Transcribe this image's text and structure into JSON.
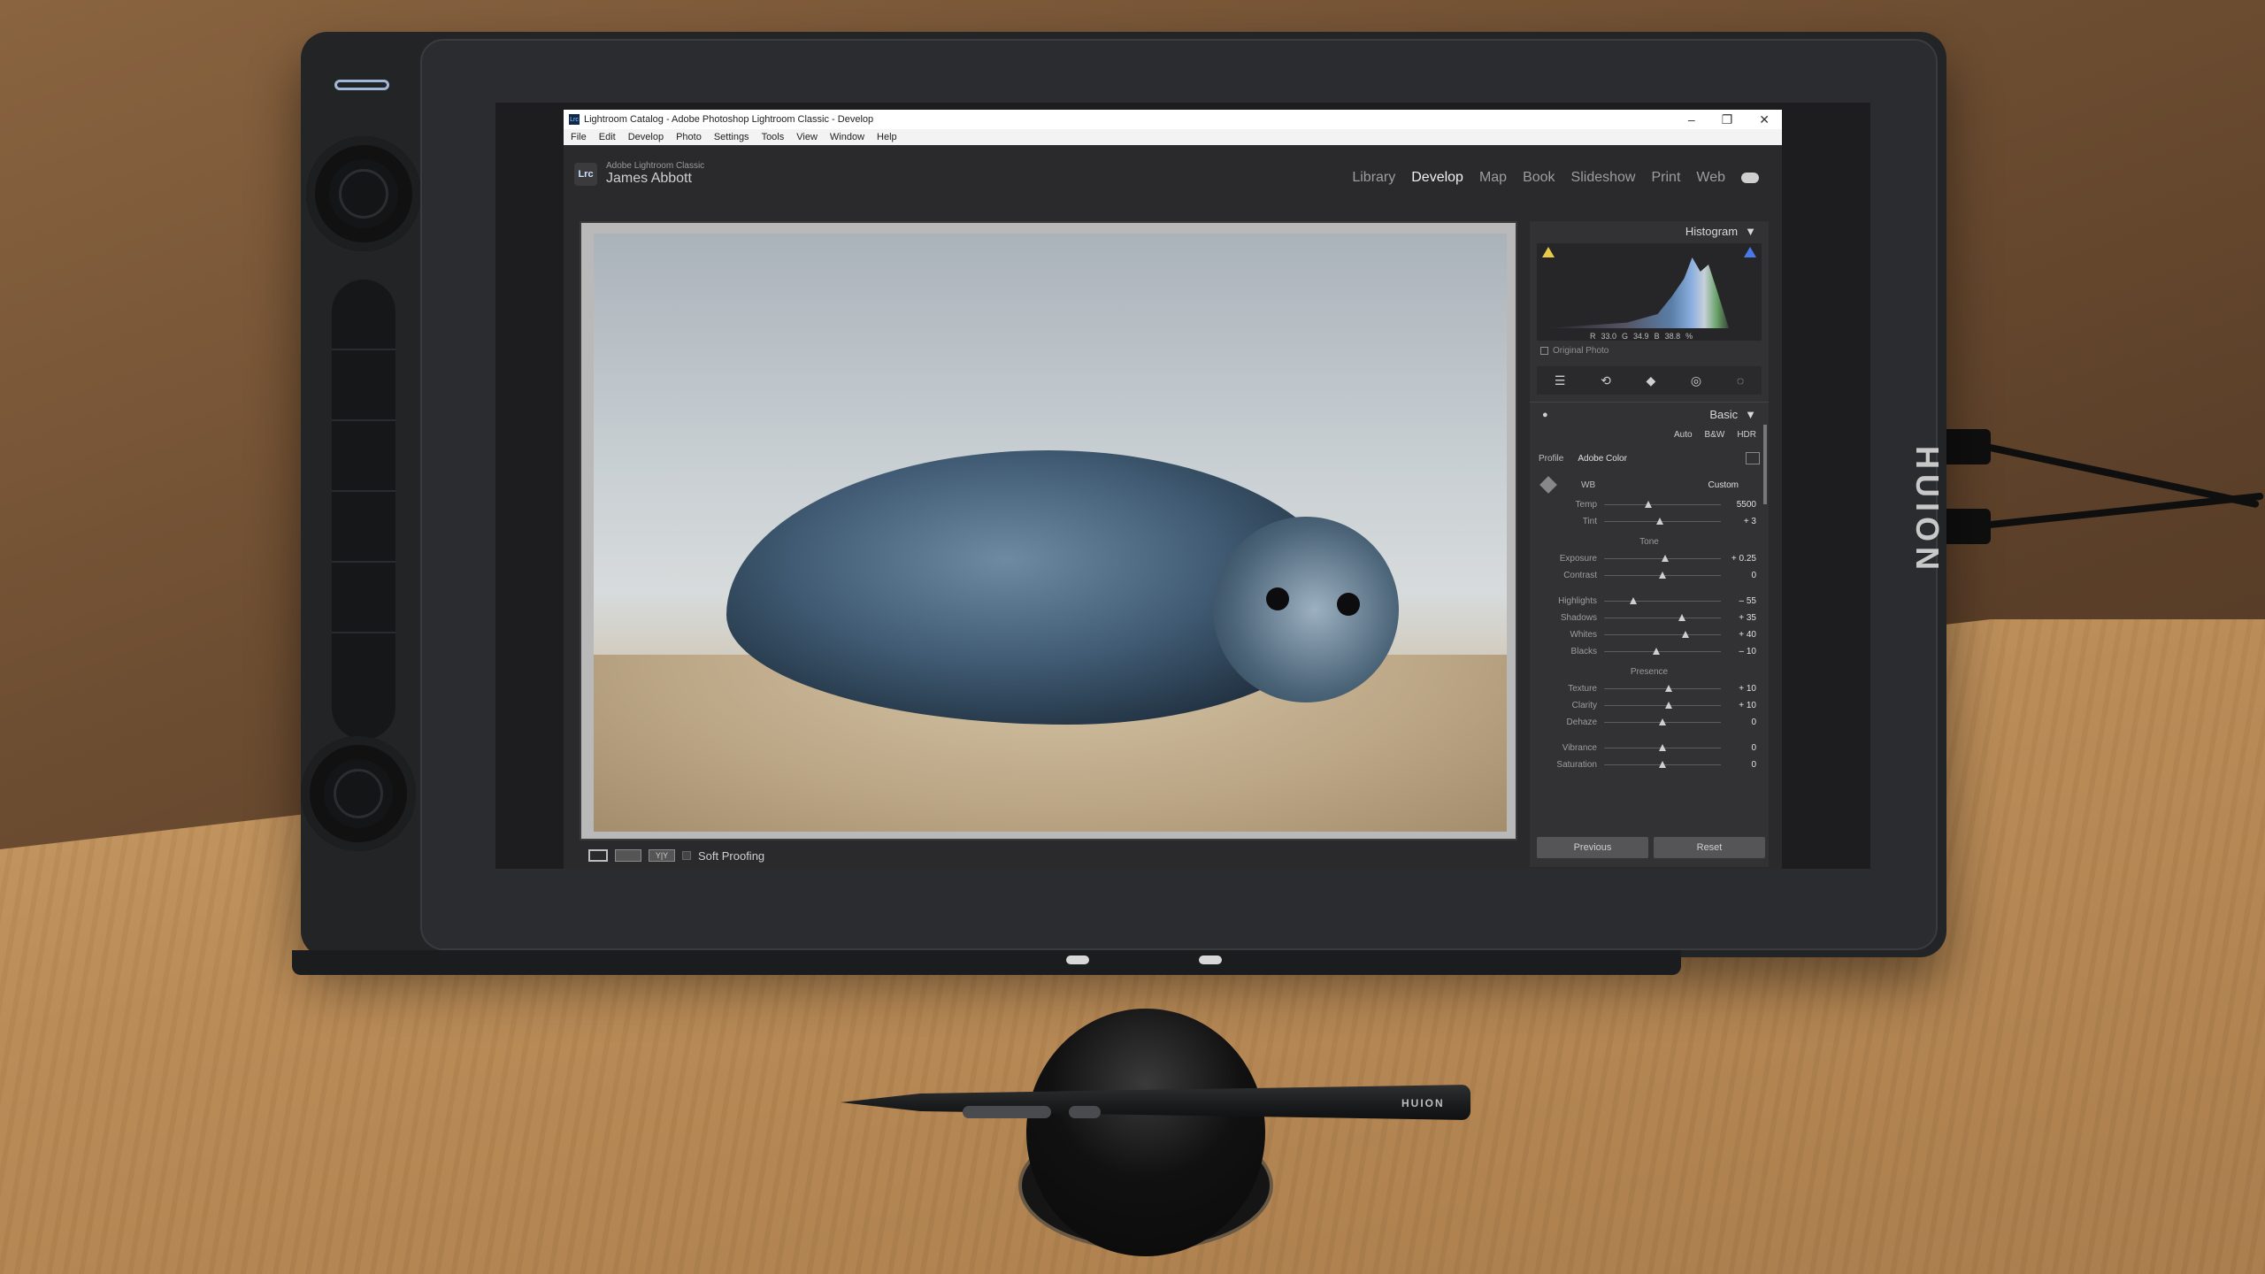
{
  "window": {
    "title": "Lightroom Catalog - Adobe Photoshop Lightroom Classic - Develop",
    "app_badge": "Lrc",
    "controls": [
      "–",
      "❐",
      "✕"
    ]
  },
  "menubar": {
    "items": [
      "File",
      "Edit",
      "Develop",
      "Photo",
      "Settings",
      "Tools",
      "View",
      "Window",
      "Help"
    ]
  },
  "identity_plate": {
    "product": "Adobe Lightroom Classic",
    "user": "James Abbott"
  },
  "modules": {
    "items": [
      "Library",
      "Develop",
      "Map",
      "Book",
      "Slideshow",
      "Print",
      "Web"
    ],
    "active": "Develop"
  },
  "histogram": {
    "title": "Histogram",
    "r_label": "R",
    "r_value": "33.0",
    "g_label": "G",
    "g_value": "34.9",
    "b_label": "B",
    "b_value": "38.8",
    "unit": "%",
    "original_photo": "Original Photo"
  },
  "basic_panel": {
    "title": "Basic",
    "treatment": [
      "Auto",
      "B&W",
      "HDR"
    ],
    "profile_label": "Profile",
    "profile_value": "Adobe Color",
    "wb_label": "WB",
    "wb_value": "Custom",
    "sliders_wb": [
      {
        "label": "Temp",
        "value": "5500",
        "pos": 0.38
      },
      {
        "label": "Tint",
        "value": "+ 3",
        "pos": 0.48
      }
    ],
    "tone_title": "Tone",
    "sliders_tone1": [
      {
        "label": "Exposure",
        "value": "+ 0.25",
        "pos": 0.52
      },
      {
        "label": "Contrast",
        "value": "0",
        "pos": 0.5
      }
    ],
    "sliders_tone2": [
      {
        "label": "Highlights",
        "value": "– 55",
        "pos": 0.25
      },
      {
        "label": "Shadows",
        "value": "+ 35",
        "pos": 0.67
      },
      {
        "label": "Whites",
        "value": "+ 40",
        "pos": 0.7
      },
      {
        "label": "Blacks",
        "value": "– 10",
        "pos": 0.45
      }
    ],
    "presence_title": "Presence",
    "sliders_presence1": [
      {
        "label": "Texture",
        "value": "+ 10",
        "pos": 0.55
      },
      {
        "label": "Clarity",
        "value": "+ 10",
        "pos": 0.55
      },
      {
        "label": "Dehaze",
        "value": "0",
        "pos": 0.5
      }
    ],
    "sliders_presence2": [
      {
        "label": "Vibrance",
        "value": "0",
        "pos": 0.5
      },
      {
        "label": "Saturation",
        "value": "0",
        "pos": 0.5
      }
    ],
    "previous_button": "Previous",
    "reset_button": "Reset"
  },
  "toolbar": {
    "soft_proofing": "Soft Proofing",
    "yy": "Y|Y"
  },
  "hardware": {
    "brand": "HUION",
    "pen_brand": "HUION"
  }
}
